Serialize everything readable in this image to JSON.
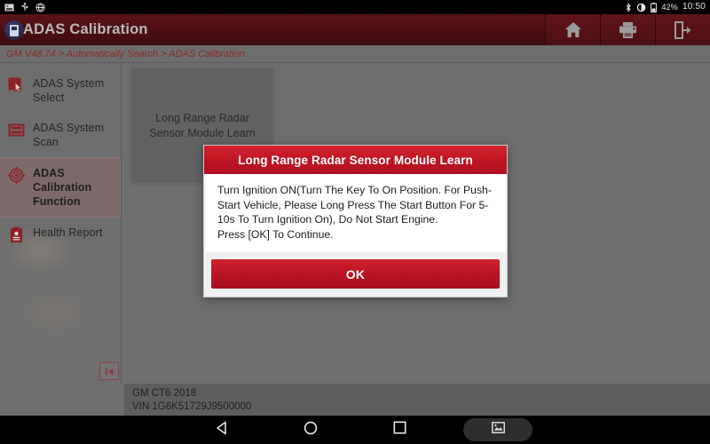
{
  "statusbar": {
    "icons": [
      "screenshot-icon",
      "usb-icon",
      "debug-icon"
    ],
    "bluetooth_icon": "bluetooth-icon",
    "brightness_icon": "brightness-icon",
    "battery_icon": "battery-icon",
    "battery_text": "42%",
    "clock": "10:50"
  },
  "header": {
    "title": "ADAS Calibration",
    "logo_icon": "adas-logo-icon",
    "actions": [
      {
        "name": "home-button",
        "icon": "home-icon"
      },
      {
        "name": "print-button",
        "icon": "printer-icon"
      },
      {
        "name": "exit-button",
        "icon": "exit-icon"
      }
    ]
  },
  "breadcrumb": {
    "text": "GM V48.74 > Automatically Search > ADAS Calibration"
  },
  "sidebar": {
    "items": [
      {
        "label": "ADAS System Select",
        "icon": "cursor-select-icon",
        "active": false
      },
      {
        "label": "ADAS System Scan",
        "icon": "scan-list-icon",
        "active": false
      },
      {
        "label": "ADAS Calibration Function",
        "icon": "target-crosshair-icon",
        "active": true
      },
      {
        "label": "Health Report",
        "icon": "clipboard-report-icon",
        "active": false
      }
    ],
    "collapse_label": "❙◀"
  },
  "main": {
    "cards": [
      {
        "label": "Long Range Radar Sensor Module Learn"
      }
    ]
  },
  "vehicle": {
    "model": "GM CT6 2018",
    "vin": "VIN 1G6K51729J9500000"
  },
  "dialog": {
    "title": "Long Range Radar Sensor Module Learn",
    "message_line1": "Turn Ignition ON(Turn The Key To On Position. For Push-Start Vehicle, Please Long Press The Start Button For 5-10s To Turn Ignition On), Do Not Start Engine.",
    "message_line2": "Press [OK] To Continue.",
    "ok_label": "OK"
  },
  "navbar": {
    "back_icon": "back-triangle-icon",
    "home_icon": "home-circle-icon",
    "recents_icon": "recents-square-icon",
    "screenshot_icon": "screenshot-pill-icon"
  },
  "colors": {
    "brand_red": "#8f2b27",
    "header_dark_red": "#4a0f13",
    "dialog_red": "#c01523",
    "panel_gray": "#6e6e6e"
  }
}
